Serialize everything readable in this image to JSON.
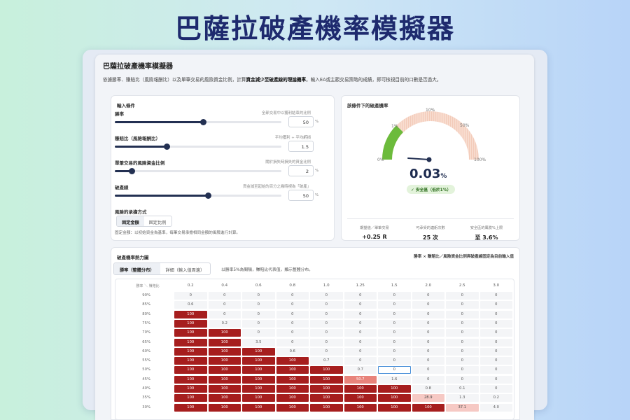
{
  "hero_title": "巴薩拉破產機率模擬器",
  "app_title": "巴薩拉破產機率模擬器",
  "description_a": "依據勝率、賺賠比（風險報酬比）以及單筆交易的風險資金比例，計算",
  "description_b": "資金減少至破產線的理論機率",
  "description_c": "。輸入EA或主觀交易策略的成績，即可核視目前的口數是否過大。",
  "inputs": {
    "title": "輸入條件",
    "rows": [
      {
        "label": "勝率",
        "hint": "全部交易中以獲利結束的比例",
        "value": "50",
        "unit": "%",
        "level": 0.53
      },
      {
        "label": "賺賠比（風險報酬比）",
        "hint": "平均獲利 ÷ 平均虧損",
        "value": "1.5",
        "unit": "",
        "level": 0.31
      },
      {
        "label": "單筆交易的風險資金比例",
        "hint": "關於損失時損失的資金比例",
        "value": "2",
        "unit": "%",
        "level": 0.1
      },
      {
        "label": "破產線",
        "hint": "資金減至起始的百分之幾時視為「破產」",
        "value": "50",
        "unit": "%",
        "level": 0.56
      }
    ],
    "risk_mode_label": "風險的承擔方式",
    "mode_fixed_amount": "固定金額",
    "mode_fixed_ratio": "固定比例",
    "mode_note": "固定金額：以初始資金為基準，每筆交易承擔相同金額的風險進行計算。"
  },
  "result": {
    "title": "該條件下的破產機率",
    "gauge_ticks": [
      "0%",
      "1%",
      "10%",
      "50%",
      "100%"
    ],
    "main_value": "0.03",
    "main_unit": "%",
    "badge": "✓ 安全區（低於1%）",
    "stats": [
      {
        "caption": "期望值／單筆交易",
        "value": "+0.25 R"
      },
      {
        "caption": "可承受的連虧次數",
        "value": "25 次"
      },
      {
        "caption": "安全區的風險%上限",
        "value": "至 3.6%"
      }
    ]
  },
  "heatmap": {
    "title": "破產機率熱力圖",
    "right_note": "勝率 × 賺賠比／風險資金比例與破產線固定為目前輸入值",
    "tab_winrate": "勝率（整體分布）",
    "tab_detail": "詳細（輸入值周邊）",
    "tab_note": "以勝率5%為間隔，賺賠比代表值，顯示整體分布。",
    "corner": "勝率 ＼ 賺賠比",
    "columns": [
      "0.2",
      "0.4",
      "0.6",
      "0.8",
      "1.0",
      "1.25",
      "1.5",
      "2.0",
      "2.5",
      "3.0"
    ],
    "rows": [
      {
        "label": "90%",
        "cells": [
          "0",
          "0",
          "0",
          "0",
          "0",
          "0",
          "0",
          "0",
          "0",
          "0"
        ]
      },
      {
        "label": "85%",
        "cells": [
          "0.6",
          "0",
          "0",
          "0",
          "0",
          "0",
          "0",
          "0",
          "0",
          "0"
        ]
      },
      {
        "label": "80%",
        "cells": [
          "100",
          "0",
          "0",
          "0",
          "0",
          "0",
          "0",
          "0",
          "0",
          "0"
        ]
      },
      {
        "label": "75%",
        "cells": [
          "100",
          "0.2",
          "0",
          "0",
          "0",
          "0",
          "0",
          "0",
          "0",
          "0"
        ]
      },
      {
        "label": "70%",
        "cells": [
          "100",
          "100",
          "0",
          "0",
          "0",
          "0",
          "0",
          "0",
          "0",
          "0"
        ]
      },
      {
        "label": "65%",
        "cells": [
          "100",
          "100",
          "3.5",
          "0",
          "0",
          "0",
          "0",
          "0",
          "0",
          "0"
        ]
      },
      {
        "label": "60%",
        "cells": [
          "100",
          "100",
          "100",
          "0.6",
          "0",
          "0",
          "0",
          "0",
          "0",
          "0"
        ]
      },
      {
        "label": "55%",
        "cells": [
          "100",
          "100",
          "100",
          "100",
          "0.7",
          "0",
          "0",
          "0",
          "0",
          "0"
        ]
      },
      {
        "label": "50%",
        "cells": [
          "100",
          "100",
          "100",
          "100",
          "100",
          "0.7",
          "0",
          "0",
          "0",
          "0"
        ]
      },
      {
        "label": "45%",
        "cells": [
          "100",
          "100",
          "100",
          "100",
          "100",
          "50.7",
          "1.6",
          "0",
          "0",
          "0"
        ]
      },
      {
        "label": "40%",
        "cells": [
          "100",
          "100",
          "100",
          "100",
          "100",
          "100",
          "100",
          "0.8",
          "0.1",
          "0"
        ]
      },
      {
        "label": "35%",
        "cells": [
          "100",
          "100",
          "100",
          "100",
          "100",
          "100",
          "100",
          "28.9",
          "1.3",
          "0.2"
        ]
      },
      {
        "label": "30%",
        "cells": [
          "100",
          "100",
          "100",
          "100",
          "100",
          "100",
          "100",
          "100",
          "37.1",
          "4.0"
        ]
      }
    ],
    "current_cell": [
      8,
      6
    ]
  },
  "colors": {
    "danger": "#a61e1e",
    "mid": "#e8837b",
    "light": "#f6c9c4",
    "zero": "#f4f5f7",
    "safe_arc": "#6cbb3c",
    "accent": "#233052"
  }
}
